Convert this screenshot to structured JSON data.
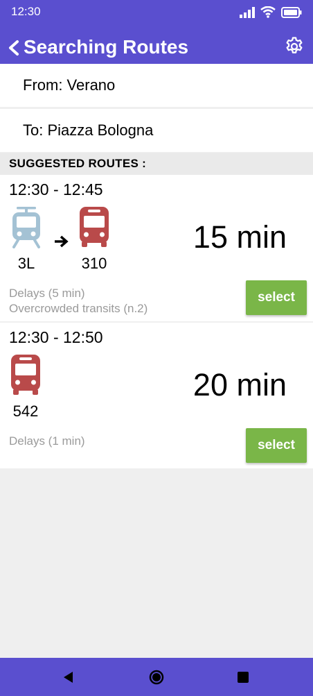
{
  "status_bar": {
    "time": "12:30",
    "icons": [
      "signal-icon",
      "wifi-icon",
      "battery-icon"
    ]
  },
  "header": {
    "title": "Searching Routes",
    "back_icon": "chevron-left-icon",
    "settings_icon": "gear-icon"
  },
  "search": {
    "from": "From: Verano",
    "to": "To: Piazza Bologna"
  },
  "suggested": {
    "heading": "SUGGESTED ROUTES :"
  },
  "routes": [
    {
      "time_range": "12:30 - 12:45",
      "legs": [
        {
          "mode": "tram-icon",
          "line": "3L",
          "color": "#a4c2d4"
        },
        {
          "mode": "bus-icon",
          "line": "310",
          "color": "#b94a4a"
        }
      ],
      "duration": "15 min",
      "notes": [
        "Delays (5 min)",
        "Overcrowded transits (n.2)"
      ],
      "select_label": "select"
    },
    {
      "time_range": "12:30 - 12:50",
      "legs": [
        {
          "mode": "bus-icon",
          "line": "542",
          "color": "#b94a4a"
        }
      ],
      "duration": "20 min",
      "notes": [
        "Delays (1 min)"
      ],
      "select_label": "select"
    }
  ],
  "nav_bar": {
    "buttons": [
      "back-triangle-icon",
      "home-circle-icon",
      "recents-square-icon"
    ]
  },
  "colors": {
    "primary": "#5a4fcf",
    "select_button": "#7ab648",
    "bus": "#b94a4a",
    "tram": "#a4c2d4",
    "note_text": "#9a9a9a"
  }
}
